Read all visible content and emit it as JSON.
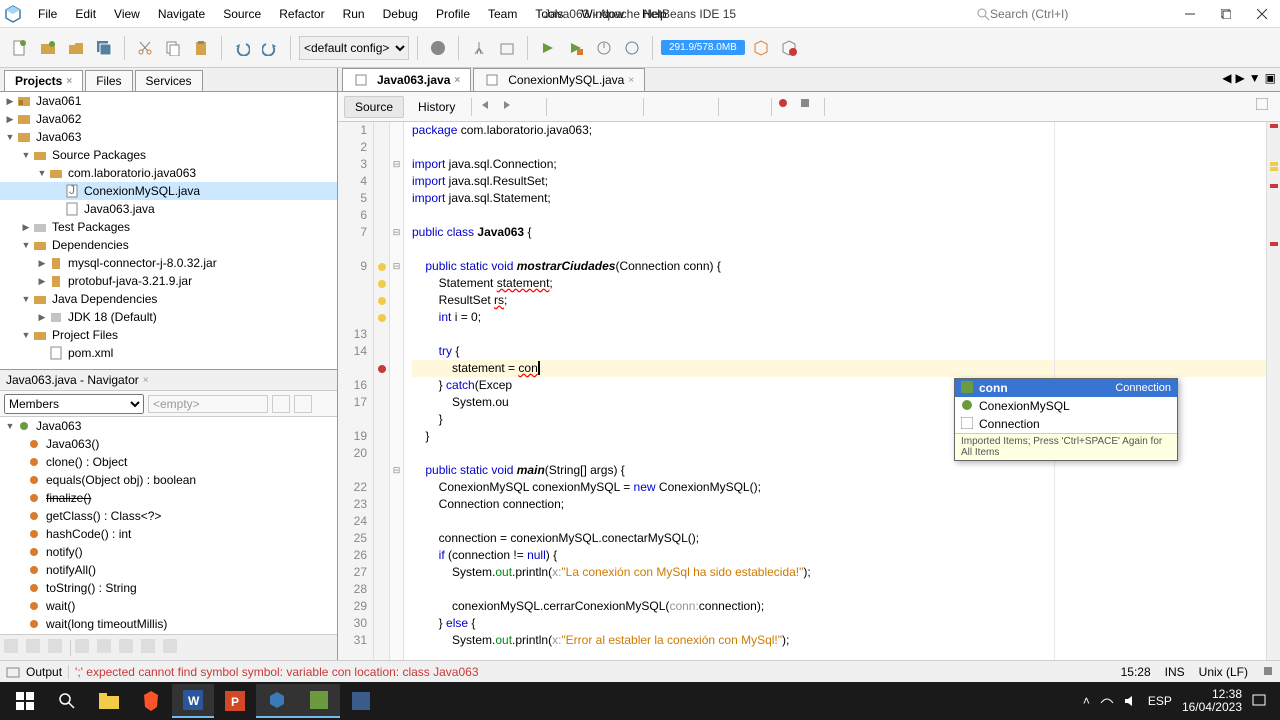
{
  "titlebar": {
    "menus": [
      "File",
      "Edit",
      "View",
      "Navigate",
      "Source",
      "Refactor",
      "Run",
      "Debug",
      "Profile",
      "Team",
      "Tools",
      "Window",
      "Help"
    ],
    "app_title": "Java063 - Apache NetBeans IDE 15",
    "search_placeholder": "Search (Ctrl+I)"
  },
  "toolbar": {
    "config": "<default config>",
    "memory": "291.9/578.0MB"
  },
  "projects": {
    "tabs": [
      "Projects",
      "Files",
      "Services"
    ],
    "active_tab": 0,
    "tree": {
      "java061": "Java061",
      "java062": "Java062",
      "java063": "Java063",
      "src_pkg": "Source Packages",
      "pkg": "com.laboratorio.java063",
      "file1": "ConexionMySQL.java",
      "file2": "Java063.java",
      "test_pkg": "Test Packages",
      "deps": "Dependencies",
      "dep1": "mysql-connector-j-8.0.32.jar",
      "dep2": "protobuf-java-3.21.9.jar",
      "java_deps": "Java Dependencies",
      "jdk": "JDK 18 (Default)",
      "proj_files": "Project Files",
      "pom": "pom.xml"
    }
  },
  "navigator": {
    "title": "Java063.java - Navigator",
    "members_label": "Members",
    "empty_label": "<empty>",
    "tree": {
      "class": "Java063",
      "ctor": "Java063()",
      "clone": "clone() : Object",
      "equals": "equals(Object obj) : boolean",
      "finalize": "finalize()",
      "getclass": "getClass() : Class<?>",
      "hashcode": "hashCode() : int",
      "notify": "notify()",
      "notifyall": "notifyAll()",
      "tostring": "toString() : String",
      "wait0": "wait()",
      "wait1": "wait(long timeoutMillis)",
      "wait2": "wait(long timeoutMillis, int nanos)"
    }
  },
  "editor": {
    "tabs": [
      {
        "label": "Java063.java",
        "active": true
      },
      {
        "label": "ConexionMySQL.java",
        "active": false
      }
    ],
    "source_label": "Source",
    "history_label": "History",
    "line_numbers": [
      "1",
      "2",
      "3",
      "4",
      "5",
      "6",
      "7",
      "",
      "9",
      "",
      "",
      "",
      "13",
      "14",
      "",
      "16",
      "17",
      "",
      "19",
      "20",
      "",
      "22",
      "23",
      "24",
      "25",
      "26",
      "27",
      "28",
      "29",
      "30",
      "31"
    ],
    "autocomplete": {
      "items": [
        {
          "label": "conn",
          "type": "Connection",
          "selected": true
        },
        {
          "label": "ConexionMySQL",
          "type": "",
          "selected": false
        },
        {
          "label": "Connection",
          "type": "",
          "selected": false
        }
      ],
      "footer": "Imported Items; Press 'Ctrl+SPACE' Again for All Items"
    }
  },
  "statusbar": {
    "output": "Output",
    "error": "';' expected   cannot find symbol   symbol:   variable con   location: class Java063",
    "col": "15:28",
    "ins": "INS",
    "encoding": "Unix (LF)"
  },
  "taskbar": {
    "time": "12:38",
    "date": "16/04/2023"
  },
  "code": {
    "l1_pkg": "package",
    "l1_rest": " com.laboratorio.java063;",
    "l3_imp": "import",
    "l3_rest": " java.sql.Connection;",
    "l4_rest": " java.sql.ResultSet;",
    "l5_rest": " java.sql.Statement;",
    "l7_pub": "public",
    "l7_cls": "class",
    "l7_name": "Java063",
    "l7_brace": " {",
    "l9_pub": "public",
    "l9_stat": "static",
    "l9_void": "void",
    "l9_meth": "mostrarCiudades",
    "l9_args": "(Connection conn) {",
    "l10": "        Statement ",
    "l10_var": "statement",
    "l10_end": ";",
    "l11": "        ResultSet ",
    "l11_var": "rs",
    "l11_end": ";",
    "l12": "        ",
    "l12_int": "int",
    "l12_rest": " i = 0;",
    "l14": "        ",
    "l14_try": "try",
    "l14_brace": " {",
    "l15": "            statement = ",
    "l15_con": "con",
    "l16": "        } ",
    "l16_catch": "catch",
    "l16_rest": "(Excep",
    "l17": "            System.",
    "l17_ou": "ou",
    "l18": "        }",
    "l19": "    }",
    "l21_pub": "public",
    "l21_stat": "static",
    "l21_void": "void",
    "l21_main": "main",
    "l21_args": "(String[] args) {",
    "l22": "        ConexionMySQL conexionMySQL = ",
    "l22_new": "new",
    "l22_rest": " ConexionMySQL();",
    "l23": "        Connection connection;",
    "l25": "        connection = conexionMySQL.conectarMySQL();",
    "l26": "        ",
    "l26_if": "if",
    "l26_cond": " (connection != ",
    "l26_null": "null",
    "l26_brace": ") {",
    "l27": "            System.",
    "l27_out": "out",
    "l27_print": ".println(",
    "l27_x": "x:",
    "l27_str": "\"La conexión con MySql ha sido establecida!\"",
    "l27_end": ");",
    "l29": "            conexionMySQL.cerrarConexionMySQL(",
    "l29_param": "conn:",
    "l29_rest": "connection);",
    "l30": "        } ",
    "l30_else": "else",
    "l30_brace": " {",
    "l31": "            System.",
    "l31_out": "out",
    "l31_print": ".println(",
    "l31_x": "x:",
    "l31_str": "\"Error al establer la conexión con MySql!\"",
    "l31_end": ");"
  }
}
